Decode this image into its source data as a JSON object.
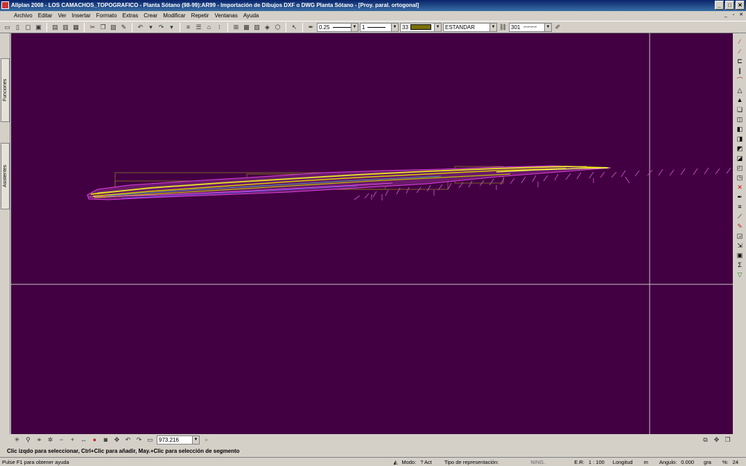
{
  "window": {
    "title": "Allplan 2008 - LOS CAMACHOS_TOPOGRAFICO - Planta Sótano (98-99):AR99 - Importación de Dibujos DXF o DWG Planta Sótano - [Proy. paral. ortogonal]",
    "minimize": "_",
    "maximize": "□",
    "close": "✕"
  },
  "menu": {
    "items": [
      "Archivo",
      "Editar",
      "Ver",
      "Insertar",
      "Formato",
      "Extras",
      "Crear",
      "Modificar",
      "Repetir",
      "Ventanas",
      "Ayuda"
    ],
    "doc_minimize": "_",
    "doc_restore": "▫",
    "doc_close": "✕"
  },
  "toolbar": {
    "pen": "0.25",
    "line": "1",
    "color": "33",
    "layer": "ESTANDAR",
    "pattern": "301",
    "color_hex": "#7a7200"
  },
  "left_dock": {
    "tab1": "Funciones",
    "tab2": "Asistentes"
  },
  "bottom_toolbar": {
    "zoom_value": "973.216"
  },
  "prompt": "Clic izqdo para seleccionar, Ctrl+Clic para añadir, May.+Clic para selección de segmento",
  "status": {
    "help": "Pulse F1 para obtener ayuda",
    "mode_label": "Modo:",
    "mode_value": "? Act",
    "repr_label": "Tipo de representación:",
    "repr_value": "NING.",
    "scale_label": "E.R:",
    "scale_value": "1 : 100",
    "length_label": "Longitud",
    "length_unit": "m",
    "angle_label": "Angulo:",
    "angle_value": "0.000",
    "angle_unit": "gra",
    "percent_label": "%:",
    "percent_value": "24"
  },
  "colors": {
    "viewport_bg": "#420042",
    "crosshair": "#c8c8c8",
    "terrain_yellow": "#d8d000",
    "terrain_magenta": "#e040e0",
    "frame_olive": "#8a7a20"
  }
}
